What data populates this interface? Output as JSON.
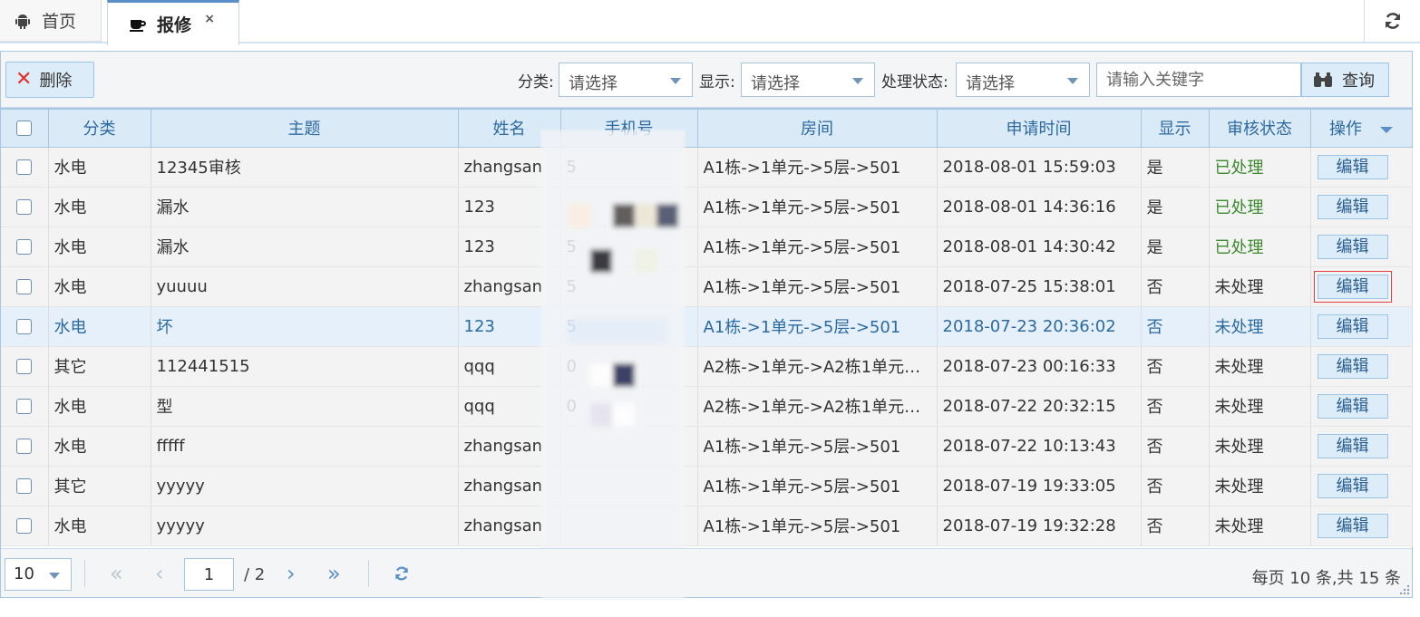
{
  "tabs": {
    "home_label": "首页",
    "repair_label": "报修",
    "close_glyph": "×"
  },
  "toolbar": {
    "delete_label": "删除",
    "category_label": "分类:",
    "category_value": "请选择",
    "display_label": "显示:",
    "display_value": "请选择",
    "status_label": "处理状态:",
    "status_value": "请选择",
    "keyword_placeholder": "请输入关键字",
    "query_label": "查询"
  },
  "grid": {
    "headers": {
      "category": "分类",
      "subject": "主题",
      "name": "姓名",
      "phone": "手机号",
      "room": "房间",
      "time": "申请时间",
      "display": "显示",
      "status": "审核状态",
      "ops": "操作"
    },
    "edit_label": "编辑",
    "rows": [
      {
        "category": "水电",
        "subject": "12345审核",
        "name": "zhangsan",
        "phone": "5",
        "room": "A1栋->1单元->5层->501",
        "time": "2018-08-01 15:59:03",
        "display": "是",
        "status": "已处理"
      },
      {
        "category": "水电",
        "subject": "漏水",
        "name": "123",
        "phone": "",
        "room": "A1栋->1单元->5层->501",
        "time": "2018-08-01 14:36:16",
        "display": "是",
        "status": "已处理"
      },
      {
        "category": "水电",
        "subject": "漏水",
        "name": "123",
        "phone": "5",
        "room": "A1栋->1单元->5层->501",
        "time": "2018-08-01 14:30:42",
        "display": "是",
        "status": "已处理"
      },
      {
        "category": "水电",
        "subject": "yuuuu",
        "name": "zhangsan",
        "phone": "5",
        "room": "A1栋->1单元->5层->501",
        "time": "2018-07-25 15:38:01",
        "display": "否",
        "status": "未处理"
      },
      {
        "category": "水电",
        "subject": "坏",
        "name": "123",
        "phone": "5",
        "room": "A1栋->1单元->5层->501",
        "time": "2018-07-23 20:36:02",
        "display": "否",
        "status": "未处理"
      },
      {
        "category": "其它",
        "subject": "112441515",
        "name": "qqq",
        "phone": "0",
        "room": "A2栋->1单元->A2栋1单元…",
        "time": "2018-07-23 00:16:33",
        "display": "否",
        "status": "未处理"
      },
      {
        "category": "水电",
        "subject": "型",
        "name": "qqq",
        "phone": "0",
        "room": "A2栋->1单元->A2栋1单元…",
        "time": "2018-07-22 20:32:15",
        "display": "否",
        "status": "未处理"
      },
      {
        "category": "水电",
        "subject": "fffff",
        "name": "zhangsan",
        "phone": "",
        "room": "A1栋->1单元->5层->501",
        "time": "2018-07-22 10:13:43",
        "display": "否",
        "status": "未处理"
      },
      {
        "category": "其它",
        "subject": "yyyyy",
        "name": "zhangsan",
        "phone": "",
        "room": "A1栋->1单元->5层->501",
        "time": "2018-07-19 19:33:05",
        "display": "否",
        "status": "未处理"
      },
      {
        "category": "水电",
        "subject": "yyyyy",
        "name": "zhangsan",
        "phone": "",
        "room": "A1栋->1单元->5层->501",
        "time": "2018-07-19 19:32:28",
        "display": "否",
        "status": "未处理"
      }
    ]
  },
  "pager": {
    "page_size": "10",
    "first": "«",
    "prev": "‹",
    "next": "›",
    "last": "»",
    "current_page": "1",
    "total_pages": "/ 2",
    "info": "每页 10 条,共 15 条"
  },
  "colors": {
    "header_bg": "#dbeaf7",
    "header_text": "#2b6aa0",
    "done_status": "#3c8a2e",
    "delete_icon": "#e0302a"
  },
  "icons": {
    "home_tab": "android-icon",
    "repair_tab": "coffee-cup-icon",
    "top_refresh": "refresh-icon",
    "delete": "close-x-icon",
    "query": "binoculars-icon",
    "pager_refresh": "refresh-icon"
  }
}
